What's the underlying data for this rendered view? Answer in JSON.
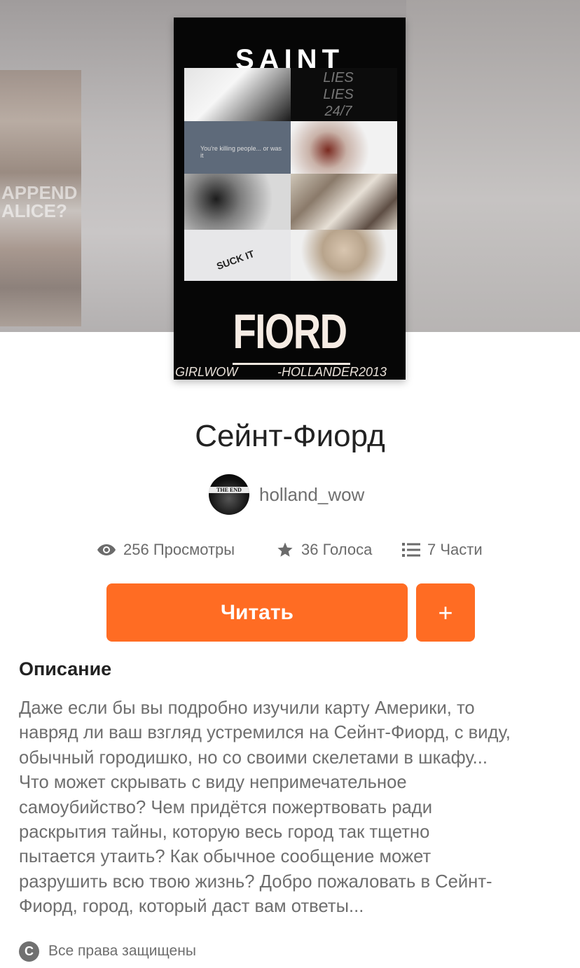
{
  "cover": {
    "top_title": "SAINT",
    "bottom_title": "FIORD",
    "footer_left": "GIRLWOW",
    "footer_right": "-HOLLANDER2013",
    "lies_text": "LIES LIES 24/7",
    "suck_it": "SUCK IT",
    "tile_caption": "You're killing people... or was it"
  },
  "background_fragment": {
    "text": "APPEND ALICE?"
  },
  "story": {
    "title": "Сейнт-Фиорд",
    "author": "holland_wow",
    "avatar_text": "THE END"
  },
  "stats": {
    "views": "256 Просмотры",
    "votes": "36 Голоса",
    "parts": "7 Части"
  },
  "actions": {
    "read_label": "Читать",
    "add_label": "+"
  },
  "description": {
    "heading": "Описание",
    "lines": [
      "Даже если бы вы  подробно изучили карту Америки, то",
      "навряд ли ваш взгляд устремился на Сейнт-Фиорд, с виду,",
      "обычный городишко, но со своими скелетами в шкафу...",
      "Что может  скрывать  с виду непримечательное",
      "самоубийство? Чем  придётся пожертвовать ради",
      "раскрытия тайны, которую весь город так тщетно",
      "пытается утаить? Как обычное сообщение может",
      "разрушить всю твою жизнь? Добро пожаловать в Сейнт-",
      "Фиорд, город, который даст вам ответы..."
    ]
  },
  "copyright": {
    "icon": "copyright-icon",
    "label": "Все права защищены"
  },
  "colors": {
    "accent": "#ff6c23",
    "text_primary": "#222222",
    "text_secondary": "#6e6e6e"
  }
}
